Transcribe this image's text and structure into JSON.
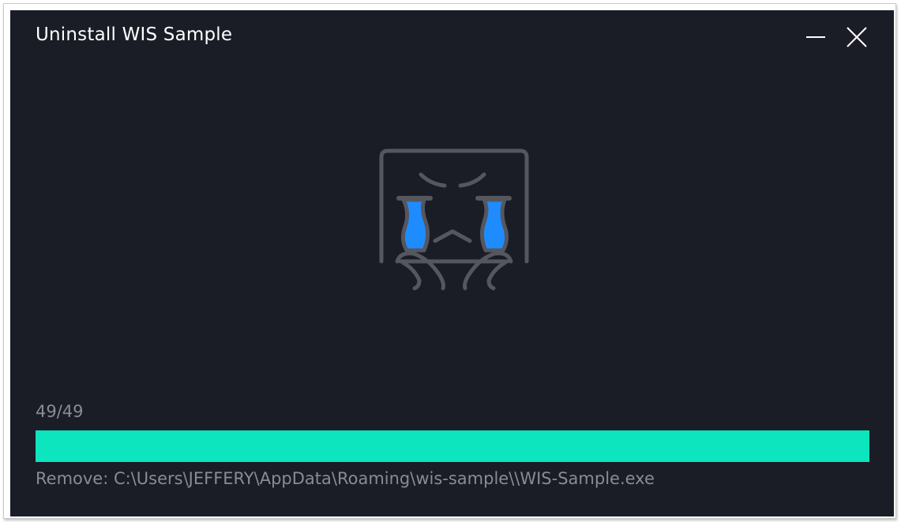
{
  "window": {
    "title": "Uninstall WIS Sample"
  },
  "controls": {
    "minimize_icon": "minimize-icon",
    "close_icon": "close-icon"
  },
  "illustration": {
    "icon": "crying-face-icon",
    "tear_color": "#1e8cff",
    "stroke_color": "#55575e"
  },
  "progress": {
    "counter": "49/49",
    "current": 49,
    "total": 49,
    "fraction": 1.0,
    "fill_color": "#0ce5bd",
    "status": "Remove: C:\\Users\\JEFFERY\\AppData\\Roaming\\wis-sample\\\\WIS-Sample.exe"
  },
  "colors": {
    "background": "#1a1c26",
    "title_text": "#ffffff",
    "muted_text": "#8a8c93"
  }
}
